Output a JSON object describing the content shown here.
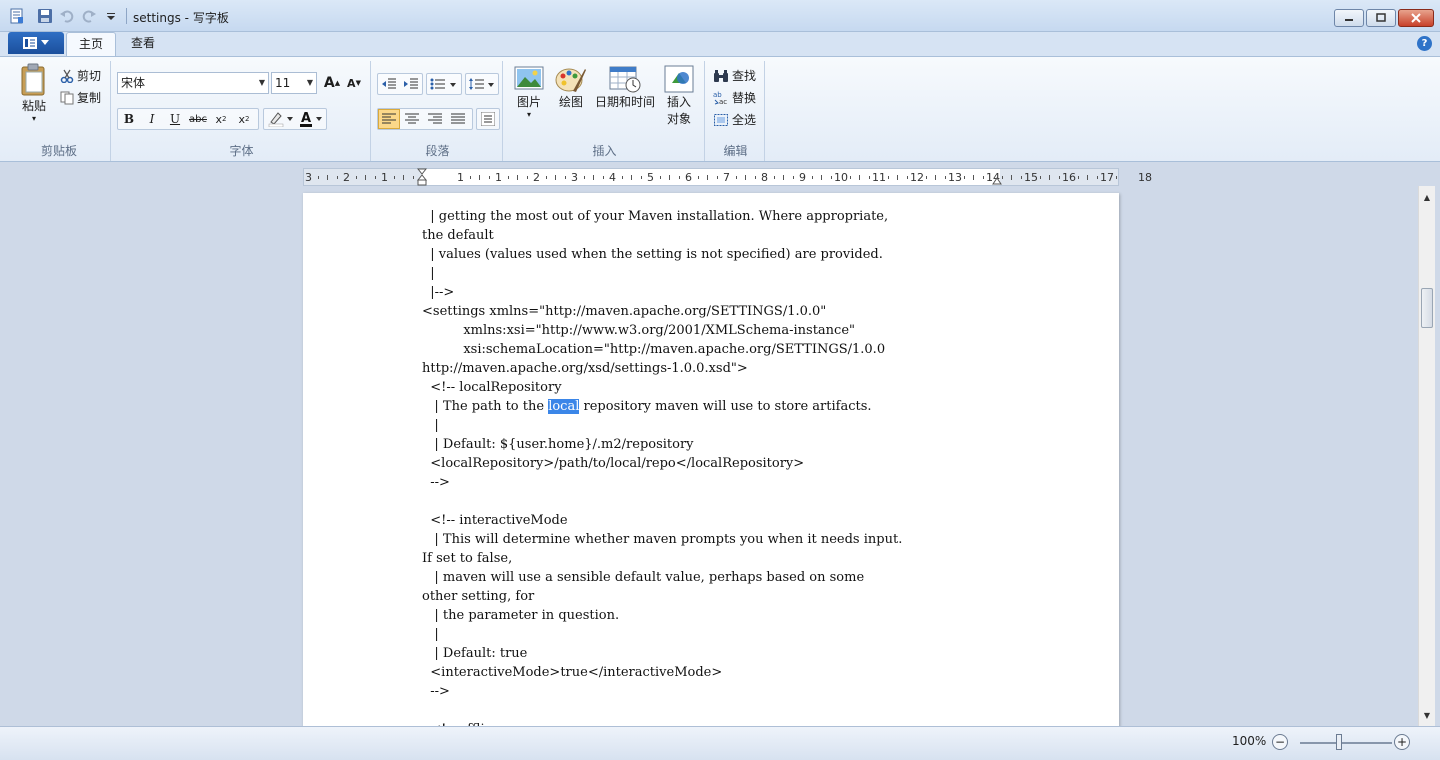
{
  "window": {
    "title": "settings - 写字板"
  },
  "tabs": [
    {
      "label": "主页",
      "active": true
    },
    {
      "label": "查看",
      "active": false
    }
  ],
  "ribbon": {
    "clipboard": {
      "label": "剪贴板",
      "paste": "粘贴",
      "cut": "剪切",
      "copy": "复制"
    },
    "font": {
      "label": "字体",
      "family": "宋体",
      "size": "11"
    },
    "paragraph": {
      "label": "段落"
    },
    "insert": {
      "label": "插入",
      "picture": "图片",
      "paint": "绘图",
      "datetime": "日期和时间",
      "object_line1": "插入",
      "object_line2": "对象"
    },
    "edit": {
      "label": "编辑",
      "find": "查找",
      "replace": "替换",
      "select_all": "全选"
    }
  },
  "ruler": {
    "labels": [
      "3",
      "2",
      "1",
      "1",
      "1",
      "2",
      "3",
      "4",
      "5",
      "6",
      "7",
      "8",
      "9",
      "10",
      "11",
      "12",
      "13",
      "14",
      "15",
      "16",
      "17",
      "18"
    ]
  },
  "document": {
    "lines_before": [
      "  | getting the most out of your Maven installation. Where appropriate,",
      "the default",
      "  | values (values used when the setting is not specified) are provided.",
      "  |",
      "  |-->",
      "<settings xmlns=\"http://maven.apache.org/SETTINGS/1.0.0\"",
      "          xmlns:xsi=\"http://www.w3.org/2001/XMLSchema-instance\"",
      "          xsi:schemaLocation=\"http://maven.apache.org/SETTINGS/1.0.0",
      "http://maven.apache.org/xsd/settings-1.0.0.xsd\">",
      "  <!-- localRepository"
    ],
    "highlight_prefix": "   | The path to the ",
    "highlight_word": "local",
    "highlight_suffix": " repository maven will use to store artifacts.",
    "lines_after": [
      "   |",
      "   | Default: ${user.home}/.m2/repository",
      "  <localRepository>/path/to/local/repo</localRepository>",
      "  -->",
      "",
      "  <!-- interactiveMode",
      "   | This will determine whether maven prompts you when it needs input.",
      "If set to false,",
      "   | maven will use a sensible default value, perhaps based on some",
      "other setting, for",
      "   | the parameter in question.",
      "   |",
      "   | Default: true",
      "  <interactiveMode>true</interactiveMode>",
      "  -->",
      "",
      "  <!-- offline"
    ]
  },
  "status": {
    "zoom": "100%"
  }
}
